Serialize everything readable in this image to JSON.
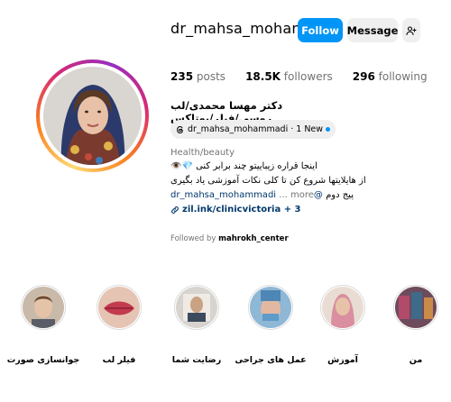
{
  "profile": {
    "username": "dr_mahsa_mohammadi",
    "follow_label": "Follow",
    "message_label": "Message",
    "suggest_icon": "person-plus-icon",
    "stats": {
      "posts_count": "235",
      "posts_label": "posts",
      "followers_count": "18.5K",
      "followers_label": "followers",
      "following_count": "296",
      "following_label": "following"
    },
    "full_name": "دکتر مهسا محمدی/لب روسی/فیلر/بوتاکس",
    "threads": {
      "icon": "threads-icon",
      "handle": "dr_mahsa_mohammadi",
      "badge": "· 1 New"
    },
    "category": "Health/beauty",
    "bio": {
      "line1": "اینجا قراره زیباییتو چند برابر کنی 💎👁️",
      "line2": "از هایلایتها شروع کن تا کلی نکات آموزشی یاد بگیری",
      "line3_prefix": "پیج دوم",
      "line3_handle": "@dr_mahsa_mohammadi",
      "line3_more": "... more"
    },
    "link": {
      "icon": "link-icon",
      "text": "zil.ink/clinicvictoria + 3"
    },
    "followed_by_prefix": "Followed by",
    "followed_by_user": "mahrokh_center",
    "accent_color": "#0095f6"
  },
  "highlights": [
    {
      "label": "جوانسازی صورت"
    },
    {
      "label": "فیلر لب"
    },
    {
      "label": "رضایت شما"
    },
    {
      "label": "عمل های جراحی"
    },
    {
      "label": "آموزش"
    },
    {
      "label": "من"
    }
  ]
}
